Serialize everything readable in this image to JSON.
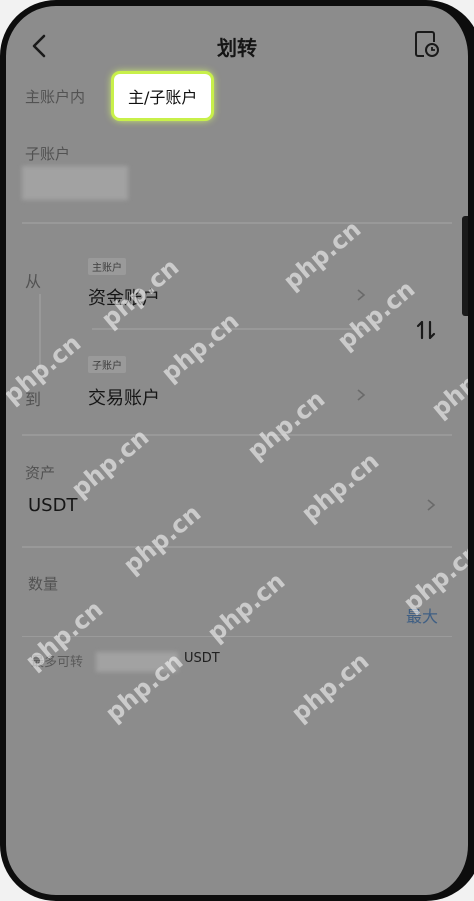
{
  "header": {
    "title": "划转",
    "back_icon": "chevron-left-icon",
    "history_icon": "document-clock-icon"
  },
  "main_account": {
    "label": "主账户内",
    "tooltip": "主/子账户"
  },
  "sub_account": {
    "label": "子账户"
  },
  "transfer": {
    "from_label": "从",
    "to_label": "到",
    "from_tag": "主账户",
    "from_account": "资金账户",
    "to_tag": "子账户",
    "to_account": "交易账户",
    "swap_icon": "swap-vertical-icon"
  },
  "asset": {
    "label": "资产",
    "value": "USDT"
  },
  "amount": {
    "label": "数量",
    "max_button": "最大",
    "max_transferable_label": "最多可转",
    "unit": "USDT"
  },
  "watermark": "php.cn",
  "colors": {
    "overlay": "#8c8c8c",
    "tooltip_glow": "#c8f04a",
    "link": "#3f5f84"
  }
}
